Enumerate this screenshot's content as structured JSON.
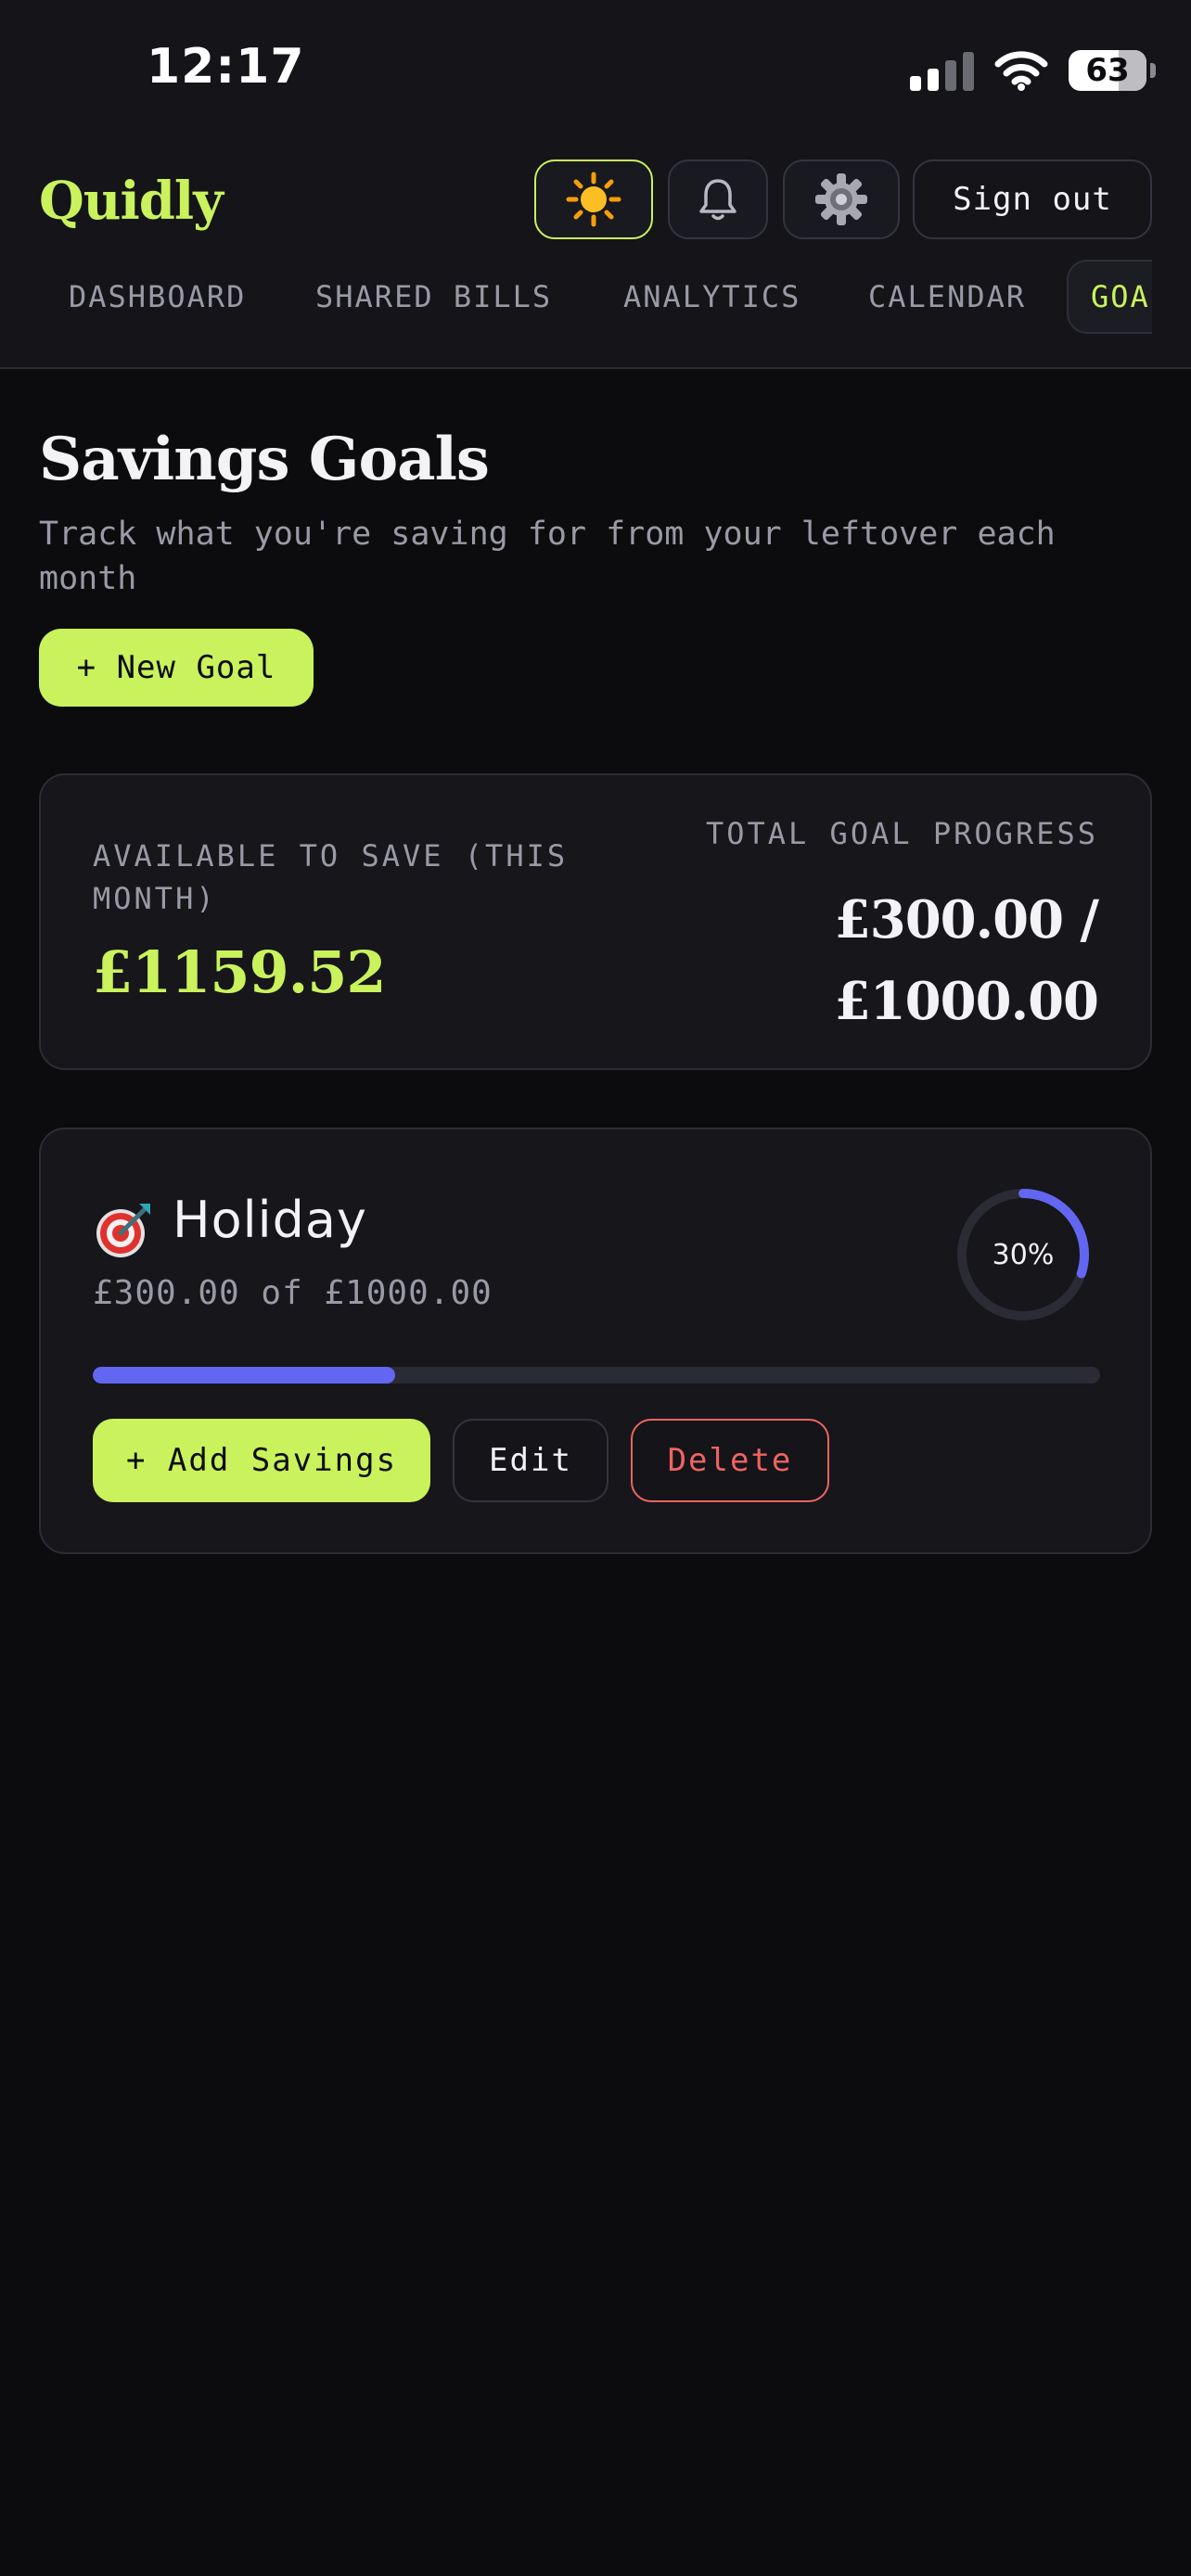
{
  "status_bar": {
    "time": "12:17",
    "battery": "63"
  },
  "header": {
    "brand": "Quidly",
    "sign_out": "Sign out",
    "icons": {
      "theme": "sun-icon",
      "notifications": "bell-icon",
      "settings": "gear-icon"
    }
  },
  "tabs": [
    {
      "label": "DASHBOARD",
      "active": false
    },
    {
      "label": "SHARED BILLS",
      "active": false
    },
    {
      "label": "ANALYTICS",
      "active": false
    },
    {
      "label": "CALENDAR",
      "active": false
    },
    {
      "label": "GOALS",
      "active": true
    }
  ],
  "page": {
    "title": "Savings Goals",
    "subtitle": "Track what you're saving for from your leftover each month",
    "new_goal_button": "+ New Goal"
  },
  "summary": {
    "available_label": "AVAILABLE TO SAVE (THIS MONTH)",
    "available_value": "£1159.52",
    "progress_label": "TOTAL GOAL PROGRESS",
    "progress_value": "£300.00 / £1000.00"
  },
  "goals": [
    {
      "icon": "target-icon",
      "name": "Holiday",
      "amount_text": "£300.00 of £1000.00",
      "percent_label": "30%",
      "progress": 0.3,
      "add_button": "+ Add Savings",
      "edit_button": "Edit",
      "delete_button": "Delete"
    }
  ],
  "colors": {
    "accent": "#c9f25c",
    "progress": "#6366f1",
    "danger": "#ef6461",
    "background": "#0c0c0f",
    "card": "#16161b"
  }
}
